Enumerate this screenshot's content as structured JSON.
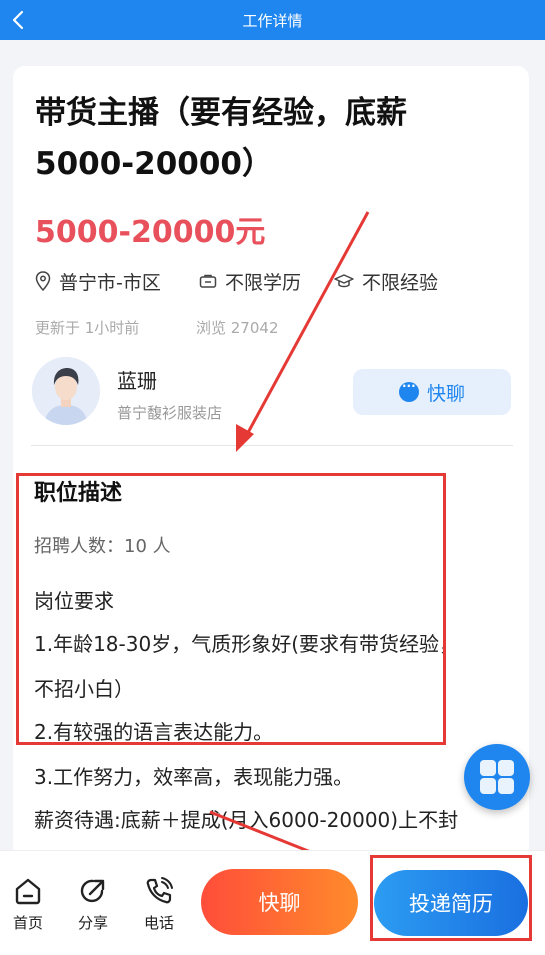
{
  "header": {
    "title": "工作详情"
  },
  "job": {
    "title": "带货主播（要有经验，底薪5000-20000）",
    "salary": "5000-20000元",
    "location": "普宁市-市区",
    "education": "不限学历",
    "experience": "不限经验",
    "updated": "更新于 1小时前",
    "views": "浏览 27042"
  },
  "recruiter": {
    "name": "蓝珊",
    "company": "普宁馥衫服装店",
    "chat_label": "快聊"
  },
  "description": {
    "title": "职位描述",
    "headcount": "招聘人数：10 人",
    "lines": [
      "岗位要求",
      "1.年龄18-30岁，气质形象好(要求有带货经验，",
      "不招小白）",
      "2.有较强的语言表达能力。",
      "3.工作努力，效率高，表现能力强。",
      "薪资待遇:底薪＋提成(月入6000-20000)上不封"
    ]
  },
  "bottom_bar": {
    "home": "首页",
    "share": "分享",
    "phone": "电话",
    "chat": "快聊",
    "apply": "投递简历"
  },
  "colors": {
    "primary": "#1f86ef",
    "salary": "#e8505b",
    "annotation": "#e53935"
  }
}
